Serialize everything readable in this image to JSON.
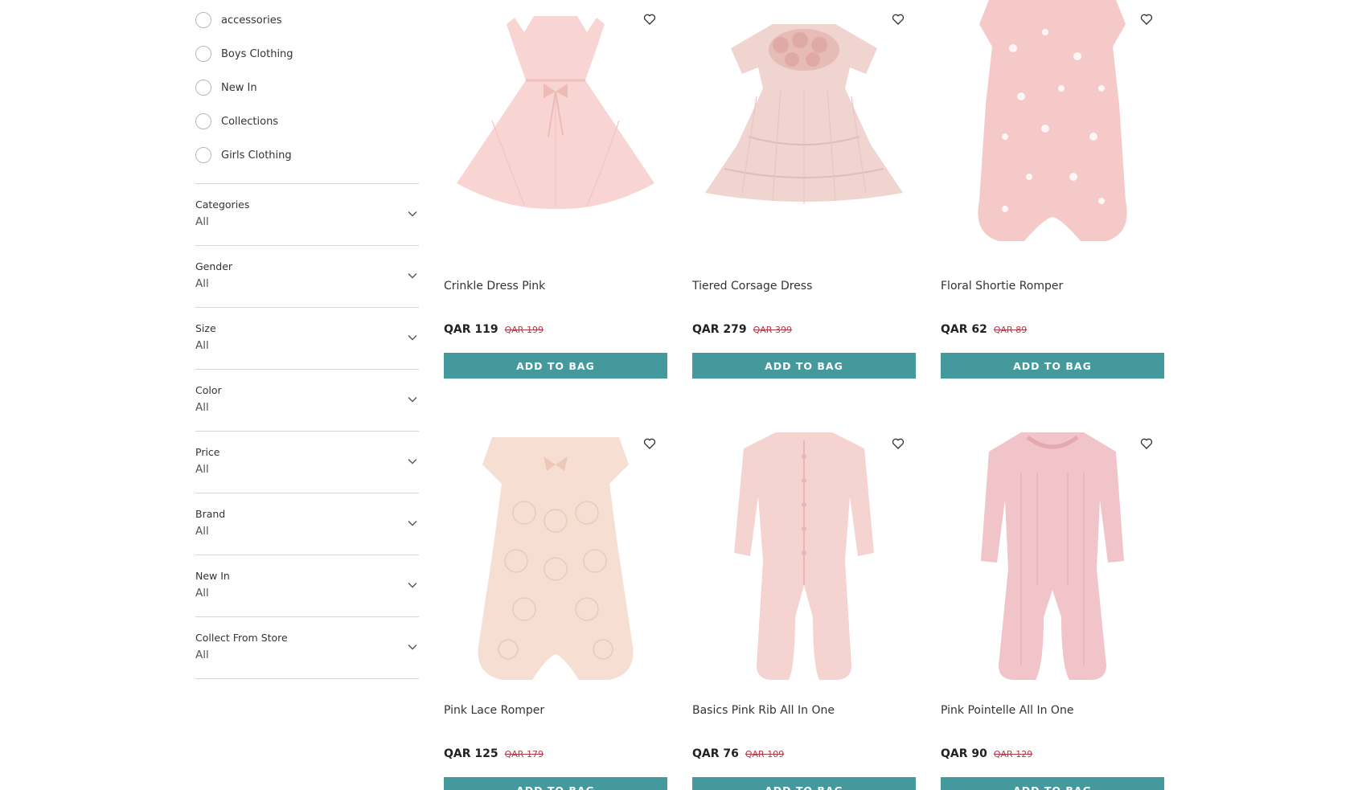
{
  "sidebar": {
    "radio_options": [
      {
        "label": "accessories"
      },
      {
        "label": "Boys Clothing"
      },
      {
        "label": "New In"
      },
      {
        "label": "Collections"
      },
      {
        "label": "Girls Clothing"
      }
    ],
    "filters": [
      {
        "title": "Categories",
        "value": "All"
      },
      {
        "title": "Gender",
        "value": "All"
      },
      {
        "title": "Size",
        "value": "All"
      },
      {
        "title": "Color",
        "value": "All"
      },
      {
        "title": "Price",
        "value": "All"
      },
      {
        "title": "Brand",
        "value": "All"
      },
      {
        "title": "New In",
        "value": "All"
      },
      {
        "title": "Collect From Store",
        "value": "All"
      }
    ]
  },
  "products": [
    {
      "name": "Crinkle Dress Pink",
      "price": "QAR 119",
      "old_price": "QAR 199",
      "button": "ADD TO BAG"
    },
    {
      "name": "Tiered Corsage Dress",
      "price": "QAR 279",
      "old_price": "QAR 399",
      "button": "ADD TO BAG"
    },
    {
      "name": "Floral Shortie Romper",
      "price": "QAR 62",
      "old_price": "QAR 89",
      "button": "ADD TO BAG"
    },
    {
      "name": "Pink Lace Romper",
      "price": "QAR 125",
      "old_price": "QAR 179",
      "button": "ADD TO BAG"
    },
    {
      "name": "Basics Pink Rib All In One",
      "price": "QAR 76",
      "old_price": "QAR 109",
      "button": "ADD TO BAG"
    },
    {
      "name": "Pink Pointelle All In One",
      "price": "QAR 90",
      "old_price": "QAR 129",
      "button": "ADD TO BAG"
    }
  ],
  "colors": {
    "accent": "#43999b",
    "old_price": "#b23a48",
    "divider": "#d6d6d6"
  }
}
